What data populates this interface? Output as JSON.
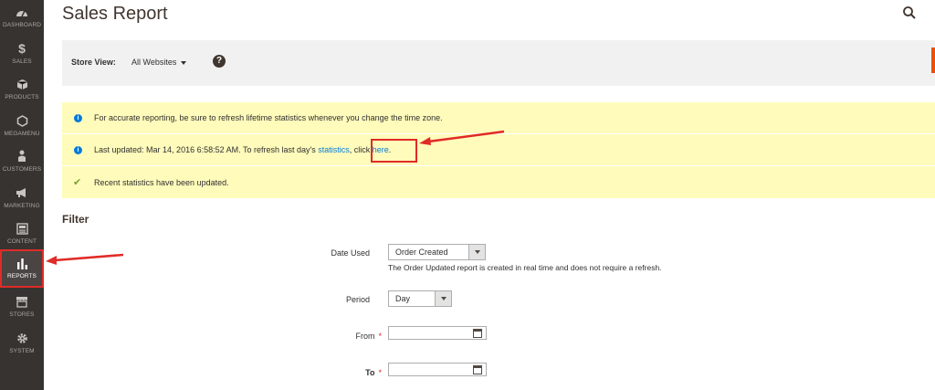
{
  "sidebar": {
    "items": [
      {
        "label": "Dashboard",
        "icon": "dashboard-icon"
      },
      {
        "label": "Sales",
        "icon": "dollar-icon"
      },
      {
        "label": "Products",
        "icon": "box-icon"
      },
      {
        "label": "Megamenu",
        "icon": "hexagon-icon"
      },
      {
        "label": "Customers",
        "icon": "person-icon"
      },
      {
        "label": "Marketing",
        "icon": "megaphone-icon"
      },
      {
        "label": "Content",
        "icon": "content-icon"
      },
      {
        "label": "Reports",
        "icon": "bar-chart-icon"
      },
      {
        "label": "Stores",
        "icon": "store-icon"
      },
      {
        "label": "System",
        "icon": "gear-icon"
      }
    ],
    "active": "Reports"
  },
  "header": {
    "title": "Sales Report"
  },
  "store_bar": {
    "label": "Store View:",
    "value": "All Websites"
  },
  "messages": {
    "tz_notice": "For accurate reporting, be sure to refresh lifetime statistics whenever you change the time zone.",
    "last_updated_prefix": "Last updated: Mar 14, 2016 6:58:52 AM. To refresh last day's ",
    "statistics_link": "statistics",
    "comma": ", ",
    "click_text": "click ",
    "here_link": "here",
    "period": ".",
    "success": "Recent statistics have been updated."
  },
  "filter": {
    "title": "Filter",
    "date_used_label": "Date Used",
    "date_used_value": "Order Created",
    "date_used_note": "The Order Updated report is created in real time and does not require a refresh.",
    "period_label": "Period",
    "period_value": "Day",
    "from_label": "From",
    "to_label": "To",
    "required_mark": "*"
  },
  "colors": {
    "sidebar_bg": "#373330",
    "notice_bg": "#fffbbb",
    "link": "#007bdb",
    "accent": "#eb5202",
    "highlight": "#e02b27"
  }
}
